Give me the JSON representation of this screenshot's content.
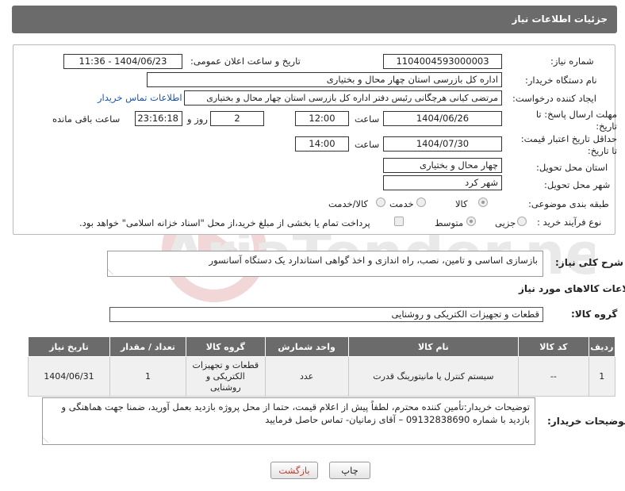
{
  "header": {
    "title": "جزئیات اطلاعات نیاز"
  },
  "form": {
    "need_number_label": "شماره نیاز:",
    "need_number": "1104004593000003",
    "announce_label": "تاریخ و ساعت اعلان عمومی:",
    "announce_value": "1404/06/23 - 11:36",
    "buyer_org_label": "نام دستگاه خریدار:",
    "buyer_org": "اداره کل بازرسی استان چهار محال و بختیاری",
    "creator_label": "ایجاد کننده درخواست:",
    "creator": "مرتضی کیانی هرچگانی رئیس دفتر اداره کل بازرسی استان چهار محال و بختیاری",
    "contact_link": "اطلاعات تماس خریدار",
    "deadline_label": "مهلت ارسال پاسخ: تا تاریخ:",
    "deadline_date": "1404/06/26",
    "time_label": "ساعت",
    "deadline_time": "12:00",
    "days_value": "2",
    "days_label": "روز و",
    "remaining_time": "23:16:18",
    "remaining_label": "ساعت باقی مانده",
    "validity_label": "حداقل تاریخ اعتبار قیمت: تا تاریخ:",
    "validity_date": "1404/07/30",
    "validity_time": "14:00",
    "province_label": "استان محل تحویل:",
    "province": "چهار محال و بختیاری",
    "city_label": "شهر محل تحویل:",
    "city": "شهر کرد",
    "category_label": "طبقه بندی موضوعی:",
    "category_options": [
      "کالا",
      "خدمت",
      "کالا/خدمت"
    ],
    "process_label": "نوع فرآیند خرید :",
    "process_options": [
      "جزیی",
      "متوسط"
    ],
    "payment_note": "پرداخت تمام یا بخشی از مبلغ خرید،از محل \"اسناد خزانه اسلامی\" خواهد بود."
  },
  "description": {
    "label": "شرح کلی نیاز:",
    "text": "بازسازی اساسی و تامین، نصب،  راه اندازی و اخذ گواهی استاندارد یک دستگاه آسانسور"
  },
  "goods": {
    "title": "اطلاعات کالاهای مورد نیاز",
    "group_label": "گروه کالا:",
    "group_value": "قطعات و تجهیزات الکتریکی و روشنایی",
    "columns": [
      "ردیف",
      "کد کالا",
      "نام کالا",
      "واحد شمارش",
      "گروه کالا",
      "تعداد / مقدار",
      "تاریخ نیاز"
    ],
    "rows": [
      {
        "index": "1",
        "code": "--",
        "name": "سیستم کنترل یا مانیتورینگ قدرت",
        "unit": "عدد",
        "group": "قطعات و تجهیزات الکتریکی و روشنایی",
        "qty": "1",
        "date": "1404/06/31"
      }
    ]
  },
  "buyer_notes": {
    "label": "توضیحات خریدار:",
    "text": "توضیحات خریدار:تأمین کننده محترم، لطفاً پیش از اعلام قیمت، حتما از محل پروژه بازدید بعمل آورید، ضمنا جهت هماهنگی و بازدید با شماره 09132838690 – آقای زمانیان- تماس حاصل فرمایید"
  },
  "buttons": {
    "print": "چاپ",
    "back": "بازگشت"
  },
  "colors": {
    "header_bg": "#6b6b6b",
    "link": "#1a55b0",
    "back_text": "#c0392b"
  }
}
